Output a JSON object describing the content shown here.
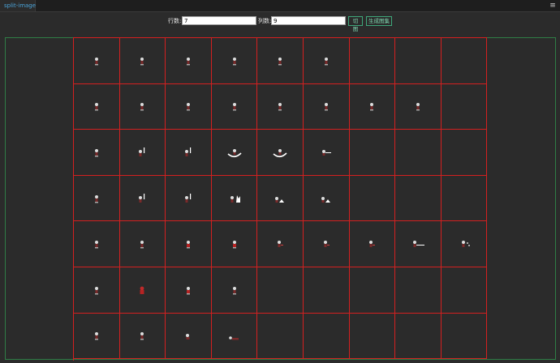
{
  "tab": {
    "label": "split-image"
  },
  "menu": {
    "icon": "hamburger-menu-icon",
    "glyph": "≡"
  },
  "controls": {
    "rows_label": "行数:",
    "rows_value": "7",
    "cols_label": "列数:",
    "cols_value": "9",
    "split_button": "切图",
    "atlas_button": "生成图集"
  },
  "colors": {
    "grid_line": "#d42020",
    "canvas_border": "#2f7d46",
    "background": "#2b2b2b",
    "button_accent": "#3fa77a"
  },
  "grid": {
    "rows": 7,
    "cols": 9,
    "cells": [
      [
        "idle",
        "idle",
        "idle",
        "idle",
        "idle",
        "idle",
        "",
        "",
        ""
      ],
      [
        "idle",
        "idle",
        "idle",
        "idle",
        "idle",
        "idle",
        "idle",
        "idle",
        ""
      ],
      [
        "idle",
        "flag",
        "flag",
        "swirl",
        "swirl",
        "slash",
        "",
        "",
        ""
      ],
      [
        "idle",
        "flag",
        "flag",
        "burst",
        "dash",
        "dash",
        "",
        "",
        ""
      ],
      [
        "idle",
        "idle",
        "red",
        "red",
        "walk",
        "walk",
        "walk",
        "shoot",
        "spark"
      ],
      [
        "idle",
        "redfull",
        "red",
        "idle",
        "",
        "",
        "",
        "",
        ""
      ],
      [
        "idle",
        "idle",
        "crouch",
        "lie",
        "",
        "",
        "",
        "",
        ""
      ]
    ]
  }
}
